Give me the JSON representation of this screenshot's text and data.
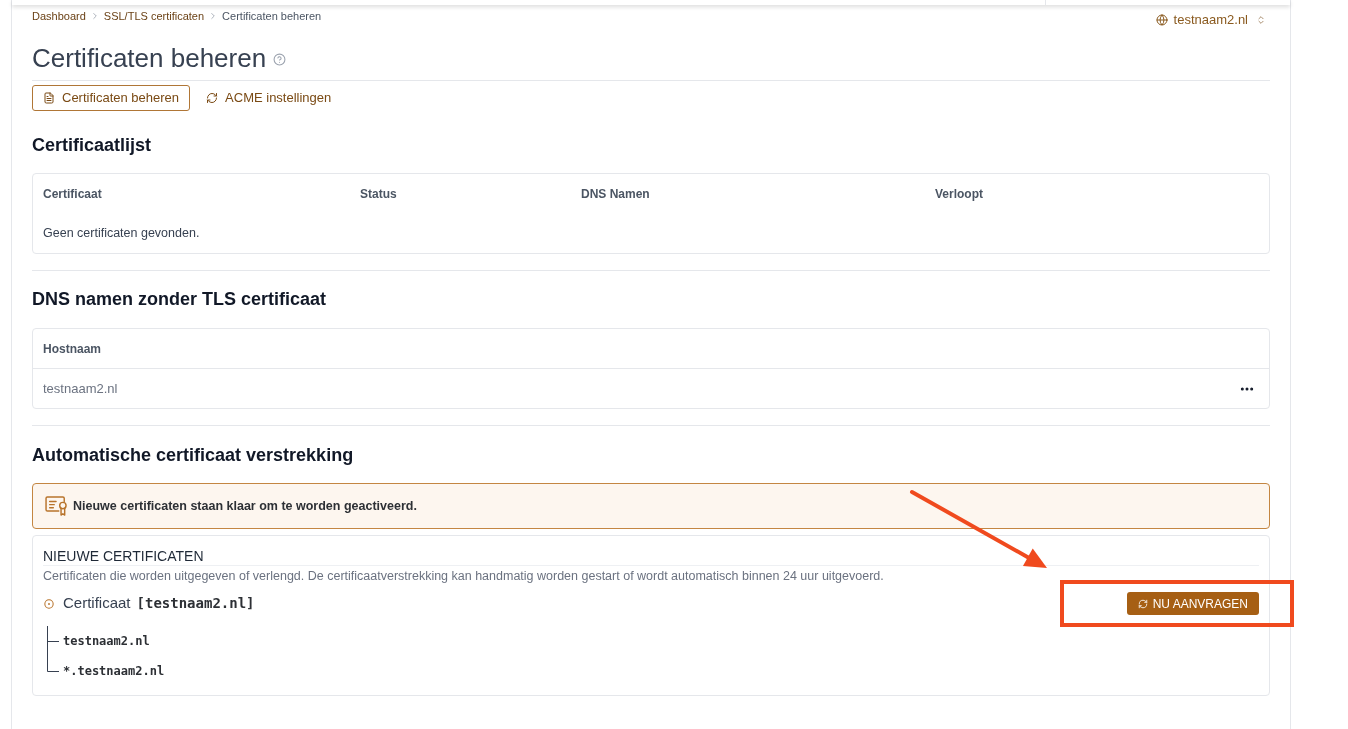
{
  "breadcrumb": [
    {
      "label": "Dashboard",
      "current": false
    },
    {
      "label": "SSL/TLS certificaten",
      "current": false
    },
    {
      "label": "Certificaten beheren",
      "current": true
    }
  ],
  "domain_selector": {
    "value": "testnaam2.nl"
  },
  "page_title": "Certificaten beheren",
  "tabs": [
    {
      "label": "Certificaten beheren",
      "selected": true
    },
    {
      "label": "ACME instellingen",
      "selected": false
    }
  ],
  "certificate_list": {
    "heading": "Certificaatlijst",
    "columns": [
      "Certificaat",
      "Status",
      "DNS Namen",
      "Verloopt"
    ],
    "empty_message": "Geen certificaten gevonden."
  },
  "dns_without_certificate": {
    "heading": "DNS namen zonder TLS certificaat",
    "columns": [
      "Hostnaam"
    ],
    "rows": [
      {
        "hostname": "testnaam2.nl"
      }
    ]
  },
  "automatic_provisioning": {
    "heading": "Automatische certificaat verstrekking",
    "alert": {
      "text": "Nieuwe certificaten staan klaar om te worden geactiveerd."
    },
    "new_certificates": {
      "title": "NIEUWE CERTIFICATEN",
      "description": "Certificaten die worden uitgegeven of verlengd. De certificaatverstrekking kan handmatig worden gestart of wordt automatisch binnen 24 uur uitgevoerd.",
      "request_button": "NU AANVRAGEN",
      "certificates": [
        {
          "label": "Certificaat",
          "name": "[testnaam2.nl]",
          "children": [
            {
              "name": "testnaam2.nl"
            },
            {
              "name": "*.testnaam2.nl"
            }
          ]
        }
      ]
    }
  },
  "annotations": [
    {
      "kind": "arrow"
    },
    {
      "kind": "frame"
    }
  ]
}
